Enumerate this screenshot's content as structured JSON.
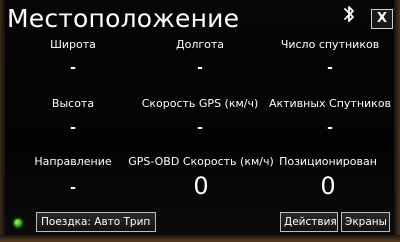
{
  "title": "Местоположение",
  "fields": [
    {
      "label": "Широта",
      "value": "-"
    },
    {
      "label": "Долгота",
      "value": "-"
    },
    {
      "label": "Число спутников",
      "value": "-"
    },
    {
      "label": "Высота",
      "value": "-"
    },
    {
      "label": "Скорость GPS (км/ч)",
      "value": "-"
    },
    {
      "label": "Активных Спутников",
      "value": "-"
    },
    {
      "label": "Направление",
      "value": "-"
    },
    {
      "label": "GPS-OBD Скорость (км/ч)",
      "value": "0"
    },
    {
      "label": "Позиционирован",
      "value": "0"
    }
  ],
  "close_label": "X",
  "trip_button_label": "Поездка: Авто Трип",
  "actions_label": "Действия",
  "screens_label": "Экраны",
  "icons": {
    "bluetooth": "bluetooth-icon",
    "status": "status-led-icon"
  },
  "colors": {
    "background": "#050505",
    "text": "#ffffff",
    "status_led": "#3ccf22"
  }
}
